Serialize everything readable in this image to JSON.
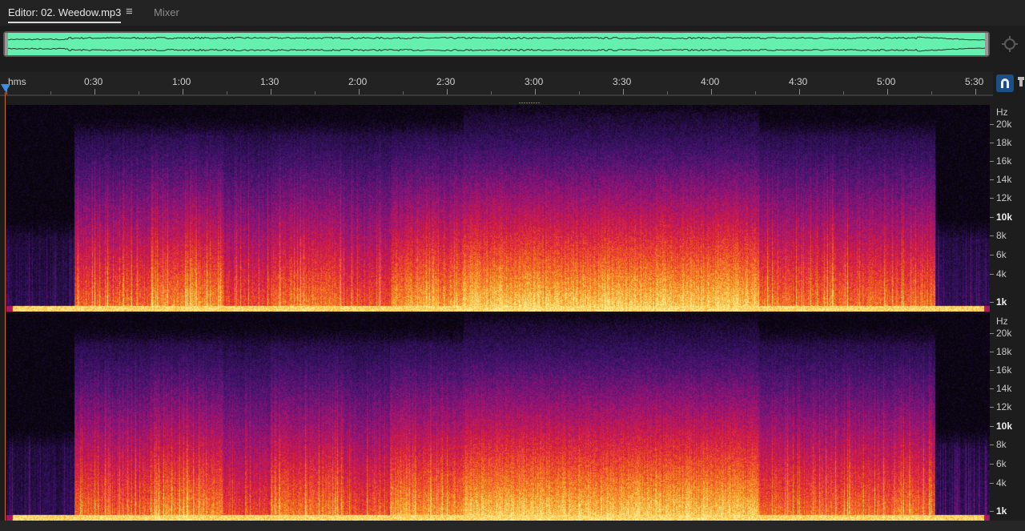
{
  "tabs": {
    "editor_label": "Editor: 02. Weedow.mp3",
    "menu_glyph": "≡",
    "mixer_label": "Mixer"
  },
  "icons": {
    "zoom": "zoom-full-icon",
    "snap": "snap-magnet-icon",
    "pin": "pin-icon"
  },
  "timeline": {
    "unit_label": "hms",
    "ticks": [
      "0:30",
      "1:00",
      "1:30",
      "2:00",
      "2:30",
      "3:00",
      "3:30",
      "4:00",
      "4:30",
      "5:00",
      "5:30"
    ]
  },
  "spectral": {
    "channels": [
      {
        "hz_label": "Hz",
        "labels": [
          "20k",
          "18k",
          "16k",
          "14k",
          "12k",
          "10k",
          "8k",
          "6k",
          "4k",
          "1k"
        ],
        "major": [
          "10k",
          "1k"
        ]
      },
      {
        "hz_label": "Hz",
        "labels": [
          "20k",
          "18k",
          "16k",
          "14k",
          "12k",
          "10k",
          "8k",
          "6k",
          "4k",
          "1k"
        ],
        "major": [
          "10k",
          "1k"
        ]
      }
    ]
  },
  "colors": {
    "waveform": "#66f0b0",
    "accent": "#3d8ee6",
    "playhead_line": "#c86a2c"
  }
}
